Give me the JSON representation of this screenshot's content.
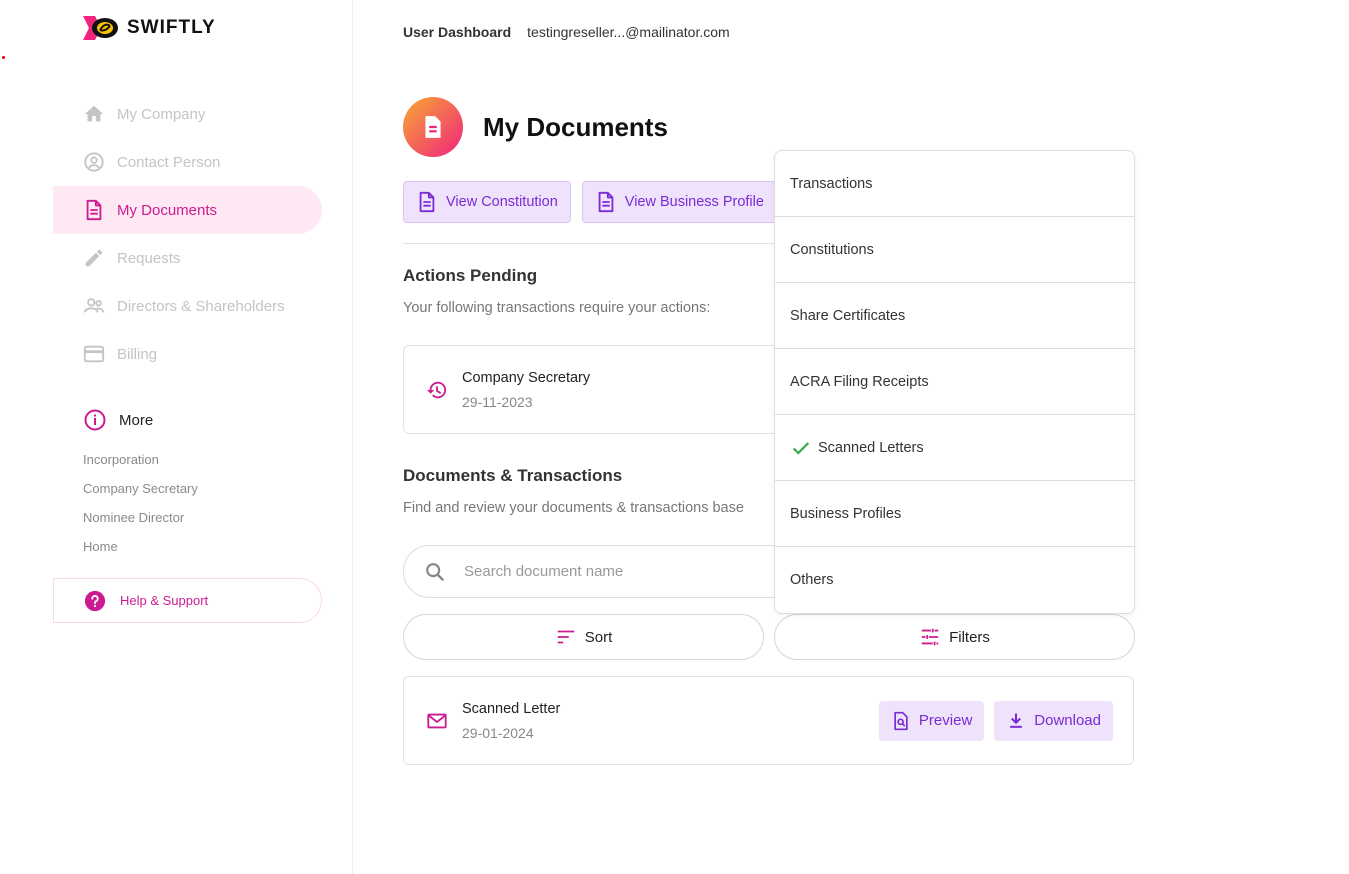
{
  "brand": {
    "name": "SWIFTLY"
  },
  "sidebar": {
    "items": [
      {
        "label": "My Company",
        "icon": "home-icon"
      },
      {
        "label": "Contact Person",
        "icon": "account-circle-icon"
      },
      {
        "label": "My Documents",
        "icon": "document-icon",
        "active": true
      },
      {
        "label": "Requests",
        "icon": "pencil-icon"
      },
      {
        "label": "Directors & Shareholders",
        "icon": "people-icon"
      },
      {
        "label": "Billing",
        "icon": "credit-card-icon"
      }
    ],
    "more_label": "More",
    "sub_links": [
      "Incorporation",
      "Company Secretary",
      "Nominee Director",
      "Home"
    ],
    "help_label": "Help & Support"
  },
  "topbar": {
    "label": "User Dashboard",
    "email": "testingreseller...@mailinator.com"
  },
  "page": {
    "title": "My Documents",
    "buttons": {
      "constitution": "View Constitution",
      "business_profile": "View Business Profile"
    }
  },
  "actions_pending": {
    "title": "Actions Pending",
    "description": "Your following transactions require your actions:",
    "item": {
      "title": "Company Secretary",
      "date": "29-11-2023"
    }
  },
  "documents": {
    "title": "Documents & Transactions",
    "description": "Find and review your documents & transactions base",
    "search_placeholder": "Search document name",
    "sort_label": "Sort",
    "filters_label": "Filters",
    "item": {
      "title": "Scanned Letter",
      "date": "29-01-2024",
      "preview_label": "Preview",
      "download_label": "Download"
    }
  },
  "filter_dropdown": {
    "options": [
      {
        "label": "Transactions",
        "checked": false
      },
      {
        "label": "Constitutions",
        "checked": false
      },
      {
        "label": "Share Certificates",
        "checked": false
      },
      {
        "label": "ACRA Filing Receipts",
        "checked": false
      },
      {
        "label": "Scanned Letters",
        "checked": true
      },
      {
        "label": "Business Profiles",
        "checked": false
      },
      {
        "label": "Others",
        "checked": false
      }
    ]
  },
  "colors": {
    "accent": "#cc1b91",
    "purple": "#7a2bd6",
    "check": "#3dab4e"
  }
}
